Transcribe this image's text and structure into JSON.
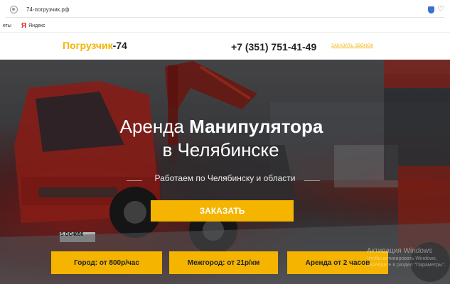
{
  "browser": {
    "url": "74-погрузчик.рф",
    "bookmarks_left": "еты",
    "bookmark_yandex_icon": "Я",
    "bookmark_yandex_label": "Яндекс"
  },
  "header": {
    "logo_part1": "Погрузчик",
    "logo_part2": "-74",
    "phone": "+7 (351) 751-41-49",
    "callback_label": "ЗАКАЗАТЬ ЗВОНОК"
  },
  "hero": {
    "title_line1_regular": "Аренда ",
    "title_line1_bold": "Манипулятора",
    "title_line2": "в Челябинске",
    "subtitle": "Работаем по Челябинску и области",
    "order_button": "ЗАКАЗАТЬ",
    "truck_plate": "S DC4856"
  },
  "services": [
    {
      "label": "Город: от 800р/час"
    },
    {
      "label": "Межгород: от 21р/км"
    },
    {
      "label": "Аренда от 2 часов"
    }
  ],
  "watermark": {
    "line1": "Активация Windows",
    "line2": "Чтобы активировать Windows, перейдите в раздел \"Параметры\"."
  },
  "colors": {
    "accent": "#f4b400",
    "text_dark": "#222222"
  }
}
